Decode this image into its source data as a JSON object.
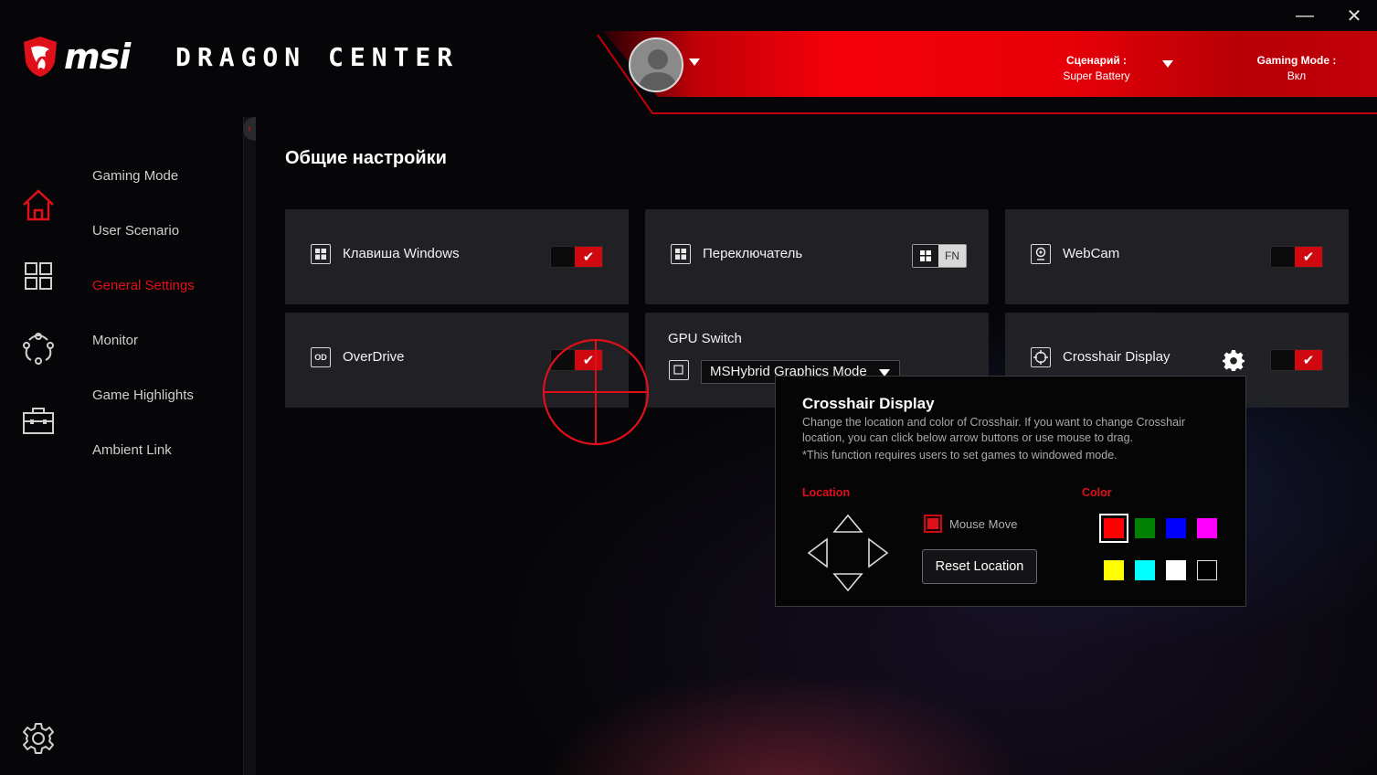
{
  "window": {
    "minimize": "—",
    "close": "✕"
  },
  "header": {
    "brand": "msi",
    "product": "DRAGON CENTER",
    "scenario_label": "Сценарий :",
    "scenario_value": "Super Battery",
    "gaming_mode_label": "Gaming Mode :",
    "gaming_mode_value": "Вкл"
  },
  "sidebar": {
    "icons": [
      "home-icon",
      "apps-grid-icon",
      "network-nodes-icon",
      "toolbox-icon",
      "settings-gear-icon"
    ],
    "items": [
      {
        "label": "Gaming Mode",
        "active": false
      },
      {
        "label": "User Scenario",
        "active": false
      },
      {
        "label": "General Settings",
        "active": true
      },
      {
        "label": "Monitor",
        "active": false
      },
      {
        "label": "Game Highlights",
        "active": false
      },
      {
        "label": "Ambient Link",
        "active": false
      }
    ],
    "collapse_glyph": "‹"
  },
  "main": {
    "title": "Общие настройки",
    "cards": {
      "windows_key": {
        "label": "Клавиша Windows",
        "on": true
      },
      "switch": {
        "label": "Переключатель",
        "fn_label": "FN"
      },
      "webcam": {
        "label": "WebCam",
        "on": true
      },
      "overdrive": {
        "label": "OverDrive",
        "icon_text": "OD",
        "on": true
      },
      "gpu_switch": {
        "title": "GPU Switch",
        "selected": "MSHybrid Graphics Mode"
      },
      "crosshair": {
        "label": "Crosshair Display",
        "on": true
      }
    },
    "check_glyph": "✔"
  },
  "popup": {
    "title": "Crosshair Display",
    "description": "Change the location and color of Crosshair. If you want to change Crosshair location, you can click below arrow buttons or use mouse to drag.",
    "note": "*This function requires users to set games to windowed mode.",
    "location_label": "Location",
    "color_label": "Color",
    "mouse_move_label": "Mouse Move",
    "mouse_move_checked": true,
    "reset_label": "Reset Location",
    "colors": [
      "#ff0000",
      "#008000",
      "#0000ff",
      "#ff00ff",
      "#ffff00",
      "#00ffff",
      "#ffffff",
      "#000000"
    ],
    "selected_color": "#ff0000"
  },
  "colors": {
    "accent": "#e0101a",
    "card": "#242428",
    "banner": "#f5000a"
  }
}
